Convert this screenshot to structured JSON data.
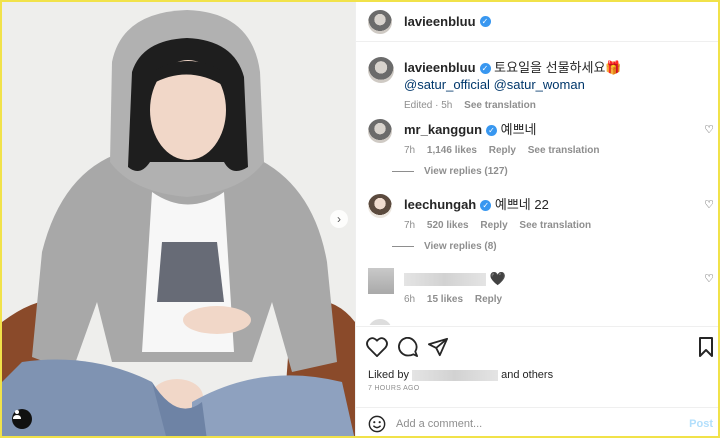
{
  "post": {
    "author": "lavieenbluu",
    "caption": {
      "username": "lavieenbluu",
      "text": "토요일을 선물하세요🎁",
      "mentions": [
        "@satur_official",
        "@satur_woman"
      ],
      "edited": "Edited · 5h",
      "see_translation": "See translation"
    }
  },
  "comments": [
    {
      "username": "mr_kanggun",
      "text": "예쁘네",
      "time": "7h",
      "likes": "1,146 likes",
      "reply": "Reply",
      "see_translation": "See translation",
      "view_replies": "View replies (127)"
    },
    {
      "username": "leechungah",
      "text": "예쁘네 22",
      "time": "7h",
      "likes": "520 likes",
      "reply": "Reply",
      "see_translation": "See translation",
      "view_replies": "View replies (8)"
    },
    {
      "username": "",
      "text": "🖤",
      "time": "6h",
      "likes": "15 likes",
      "reply": "Reply"
    }
  ],
  "actions": {
    "liked_by_prefix": "Liked by",
    "liked_by_suffix": "and others",
    "time_ago": "7 HOURS AGO",
    "comment_placeholder": "Add a comment...",
    "post_label": "Post"
  },
  "icons": {
    "next": "chevron-right-icon",
    "tag": "user-tag-icon",
    "like": "heart-icon",
    "comment": "comment-icon",
    "share": "paper-plane-icon",
    "save": "bookmark-icon",
    "emoji": "emoji-icon"
  },
  "colors": {
    "verified": "#3897f0",
    "mention": "#00376b",
    "frame": "#f1e24a",
    "post_disabled": "#b2dffc"
  }
}
